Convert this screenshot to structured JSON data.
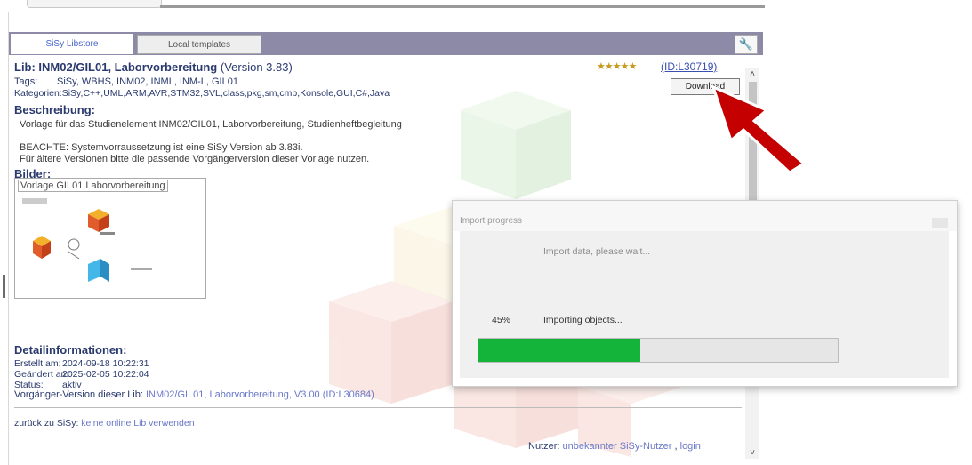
{
  "tabs": {
    "active": "SiSy Libstore",
    "inactive": "Local templates"
  },
  "lib": {
    "title": "Lib: INM02/GIL01, Laborvorbereitung",
    "version": "(Version 3.83)",
    "stars": "★★★★★",
    "id_label": "(ID:L30719)",
    "download_label": "Download"
  },
  "tags": {
    "label": "Tags:",
    "value": "SiSy, WBHS, INM02, INML, INM-L, GIL01"
  },
  "categories": {
    "label": "Kategorien:",
    "value": "SiSy,C++,UML,ARM,AVR,STM32,SVL,class,pkg,sm,cmp,Konsole,GUI,C#,Java"
  },
  "description": {
    "heading": "Beschreibung:",
    "line1": "Vorlage für das Studienelement INM02/GIL01, Laborvorbereitung, Studienheftbegleitung",
    "line2": "BEACHTE: Systemvorraussetzung ist eine SiSy Version ab 3.83i.",
    "line3": "Für ältere Versionen bitte die passende Vorgängerversion dieser Vorlage nutzen."
  },
  "images": {
    "heading": "Bilder:",
    "caption": "Vorlage GIL01 Laborvorbereitung"
  },
  "details": {
    "heading": "Detailinformationen:",
    "created_label": "Erstellt am:",
    "created_value": "2024-09-18 10:22:31",
    "changed_label": "Geändert am:",
    "changed_value": "2025-02-05 10:22:04",
    "status_label": "Status:",
    "status_value": "aktiv",
    "predecessor_label": "Vorgänger-Version dieser Lib:",
    "predecessor_link": "INM02/GIL01, Laborvorbereitung, V3.00 (ID:L30684)"
  },
  "footer": {
    "back_label": "zurück zu SiSy:",
    "back_link": "keine online Lib verwenden",
    "user_label": "Nutzer:",
    "user_link": "unbekannter SiSy-Nutzer",
    "login_link": "login"
  },
  "dialog": {
    "title": "Import progress",
    "message": "Import data, please wait...",
    "percent_label": "45%",
    "percent_value": 45,
    "status": "Importing objects..."
  },
  "colors": {
    "accent_green": "#14b33a",
    "arrow_red": "#c40000",
    "tab_bar": "#8c8aa6"
  }
}
